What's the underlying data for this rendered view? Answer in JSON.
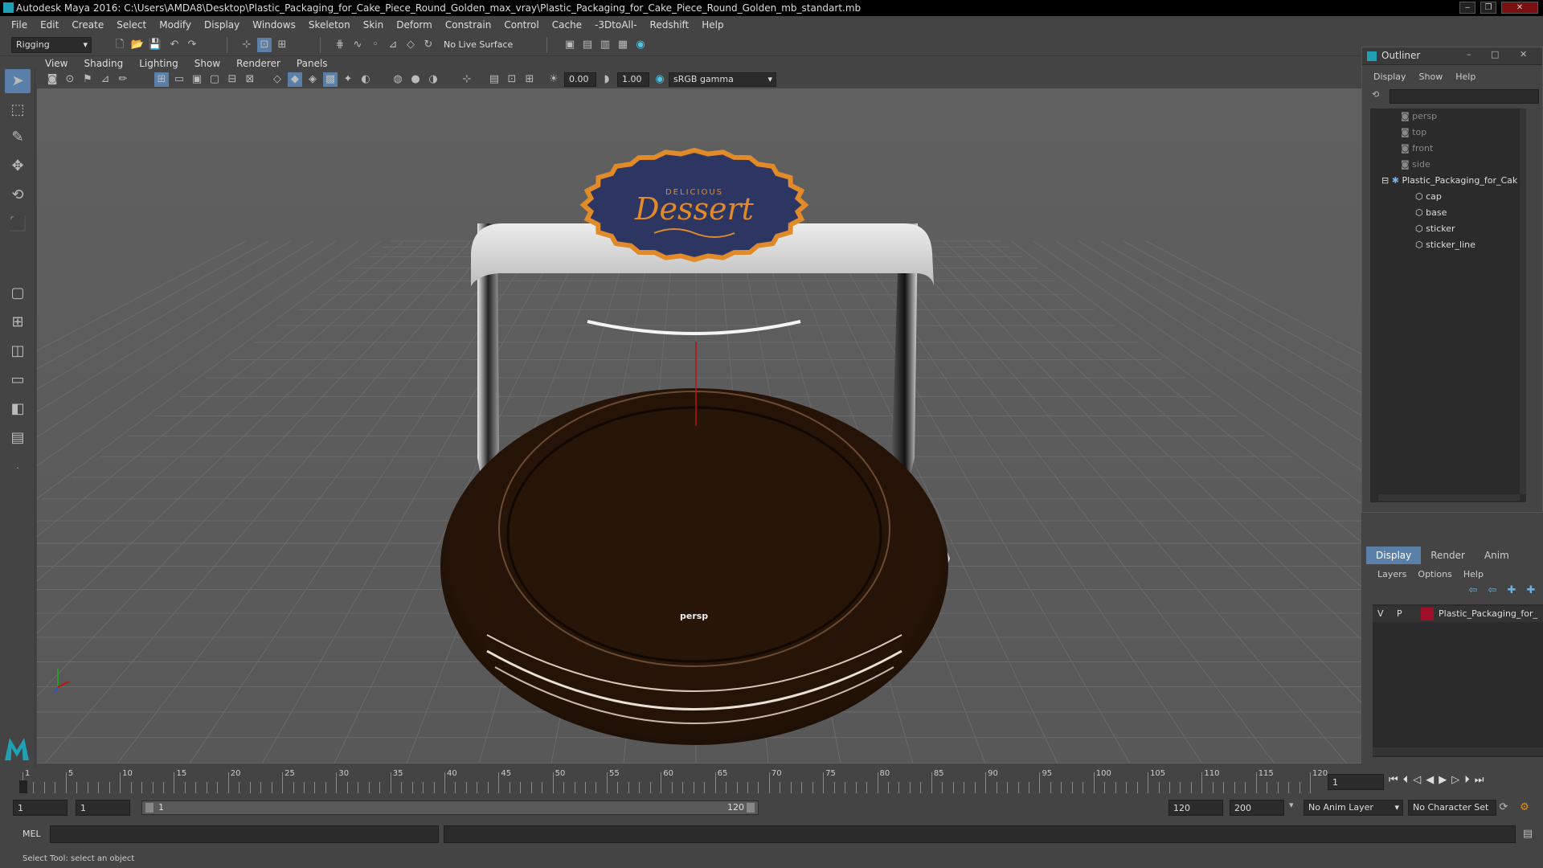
{
  "title": "Autodesk Maya 2016: C:\\Users\\AMDA8\\Desktop\\Plastic_Packaging_for_Cake_Piece_Round_Golden_max_vray\\Plastic_Packaging_for_Cake_Piece_Round_Golden_mb_standart.mb",
  "menu": [
    "File",
    "Edit",
    "Create",
    "Select",
    "Modify",
    "Display",
    "Windows",
    "Skeleton",
    "Skin",
    "Deform",
    "Constrain",
    "Control",
    "Cache",
    "-3DtoAll-",
    "Redshift",
    "Help"
  ],
  "shelf": {
    "mode": "Rigging",
    "live_surface": "No Live Surface"
  },
  "viewport_menu": [
    "View",
    "Shading",
    "Lighting",
    "Show",
    "Renderer",
    "Panels"
  ],
  "viewport_toolbar": {
    "value_a": "0.00",
    "value_b": "1.00",
    "color_space": "sRGB gamma"
  },
  "viewport": {
    "camera_label": "persp",
    "sticker_sub": "DELICIOUS",
    "sticker_main": "Dessert"
  },
  "outliner": {
    "title": "Outliner",
    "menu": [
      "Display",
      "Show",
      "Help"
    ],
    "cameras": [
      "persp",
      "top",
      "front",
      "side"
    ],
    "group": "Plastic_Packaging_for_Cak",
    "children": [
      "cap",
      "base",
      "sticker",
      "sticker_line"
    ]
  },
  "layers": {
    "tabs": [
      "Display",
      "Render",
      "Anim"
    ],
    "menu": [
      "Layers",
      "Options",
      "Help"
    ],
    "visible_flag": "V",
    "playback_flag": "P",
    "layer_name": "Plastic_Packaging_for_",
    "layer_color": "#a0102a"
  },
  "timeline": {
    "ticks": [
      "1",
      "5",
      "10",
      "15",
      "20",
      "25",
      "30",
      "35",
      "40",
      "45",
      "50",
      "55",
      "60",
      "65",
      "70",
      "75",
      "80",
      "85",
      "90",
      "95",
      "100",
      "105",
      "110",
      "115",
      "120"
    ],
    "current_frame": "1"
  },
  "range": {
    "start": "1",
    "playback_start": "1",
    "slider_start": "1",
    "slider_end": "120",
    "playback_end": "120",
    "end": "200",
    "anim_layer": "No Anim Layer",
    "char_set": "No Character Set"
  },
  "cmd": {
    "label": "MEL"
  },
  "help": "Select Tool: select an object",
  "colors": {
    "accent": "#1fa0b4",
    "sticker": "#2d3663",
    "sticker_border": "#e08a2a",
    "base": "#2a1708"
  }
}
